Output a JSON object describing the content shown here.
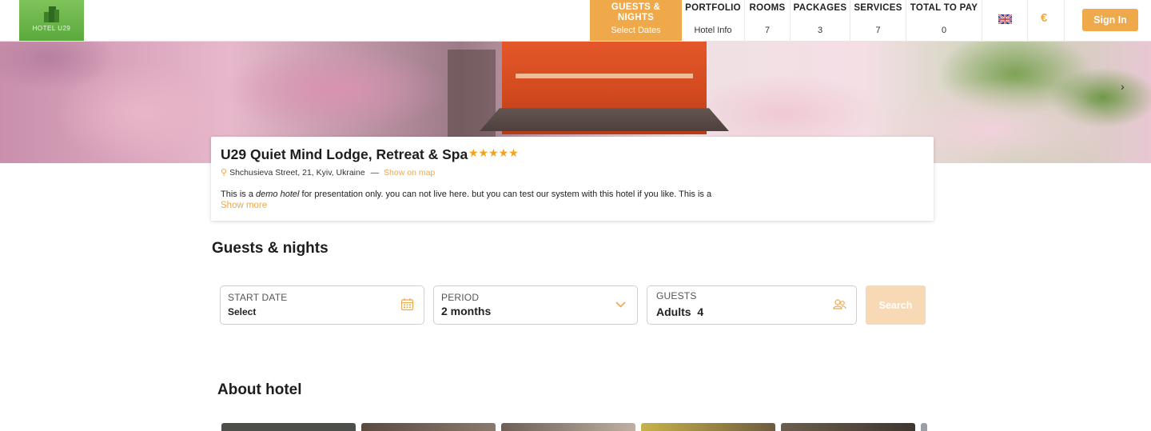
{
  "header": {
    "logo_text": "HOTEL U29",
    "nav": [
      {
        "title": "GUESTS & NIGHTS",
        "sub": "Select Dates",
        "active": true
      },
      {
        "title": "PORTFOLIO",
        "sub": "Hotel Info"
      },
      {
        "title": "ROOMS",
        "sub": "7"
      },
      {
        "title": "PACKAGES",
        "sub": "3"
      },
      {
        "title": "SERVICES",
        "sub": "7"
      },
      {
        "title": "TOTAL TO PAY",
        "sub": "0"
      }
    ],
    "language_icon": "uk-flag-icon",
    "currency": "€",
    "sign_in": "Sign In"
  },
  "hotel": {
    "name": "U29 Quiet Mind Lodge, Retreat & Spa",
    "stars": "★★★★★",
    "address": "Shchusieva Street, 21, Kyiv, Ukraine",
    "separator": "—",
    "map_link": "Show on map",
    "desc_before": "This is a ",
    "desc_em": "demo hotel",
    "desc_after": " for presentation only. you can not live here. but you can test our system with this hotel if you like. This is a",
    "show_more": "Show more"
  },
  "booking": {
    "title": "Guests & nights",
    "start_date": {
      "label": "START DATE",
      "value": "Select"
    },
    "period": {
      "label": "PERIOD",
      "value": "2 months"
    },
    "guests": {
      "label": "GUESTS",
      "value": "Adults  4"
    },
    "search": "Search"
  },
  "about": {
    "title": "About hotel"
  },
  "colors": {
    "accent": "#efa84a",
    "logo_green": "#6bb548"
  }
}
